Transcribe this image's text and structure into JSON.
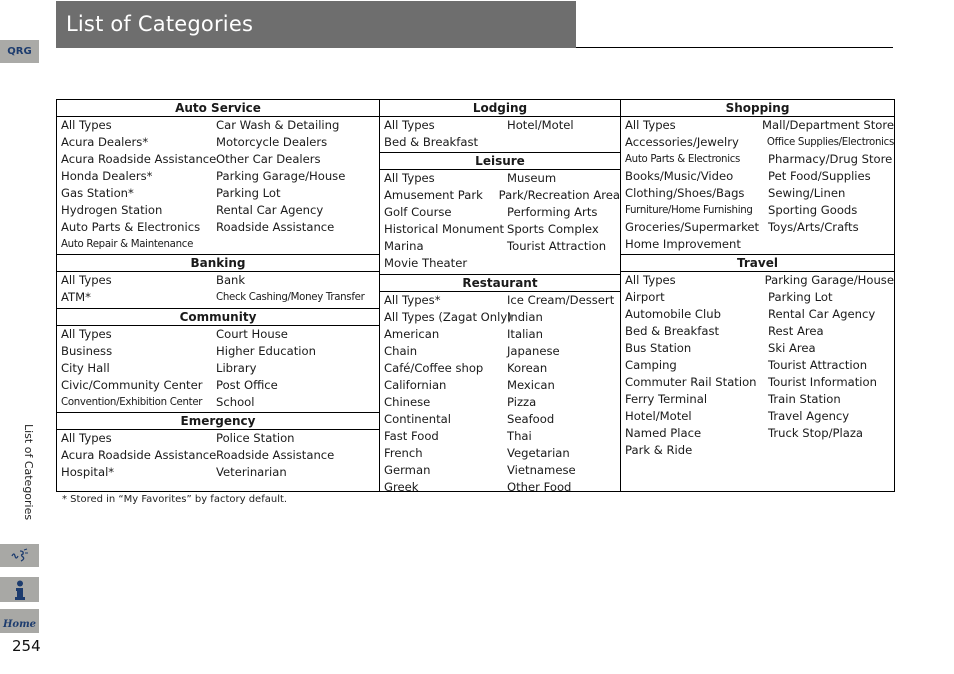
{
  "header": {
    "title": "List of Categories"
  },
  "sidebar": {
    "qrg_label": "QRG",
    "vertical_label": "List of Categories",
    "buttons": [
      {
        "name": "voice-command-icon",
        "glyph": "ɰ∉"
      },
      {
        "name": "info-icon",
        "glyph": "i"
      },
      {
        "name": "home-icon",
        "label": "Home"
      }
    ],
    "page_number": "254"
  },
  "columns": [
    {
      "sections": [
        {
          "title": "Auto Service",
          "rows": [
            [
              "All Types",
              "Car Wash & Detailing"
            ],
            [
              "Acura Dealers*",
              "Motorcycle Dealers"
            ],
            [
              "Acura Roadside Assistance",
              "Other Car Dealers"
            ],
            [
              "Honda Dealers*",
              "Parking Garage/House"
            ],
            [
              "Gas Station*",
              "Parking Lot"
            ],
            [
              "Hydrogen Station",
              "Rental Car Agency"
            ],
            [
              "Auto Parts & Electronics",
              "Roadside Assistance"
            ],
            [
              "Auto Repair & Maintenance",
              ""
            ]
          ]
        },
        {
          "title": "Banking",
          "rows": [
            [
              "All Types",
              "Bank"
            ],
            [
              "ATM*",
              "Check Cashing/Money Transfer"
            ]
          ]
        },
        {
          "title": "Community",
          "rows": [
            [
              "All Types",
              "Court House"
            ],
            [
              "Business",
              "Higher Education"
            ],
            [
              "City Hall",
              "Library"
            ],
            [
              "Civic/Community Center",
              "Post Office"
            ],
            [
              "Convention/Exhibition Center",
              "School"
            ]
          ]
        },
        {
          "title": "Emergency",
          "rows": [
            [
              "All Types",
              "Police Station"
            ],
            [
              "Acura Roadside Assistance",
              "Roadside Assistance"
            ],
            [
              "Hospital*",
              "Veterinarian"
            ]
          ]
        }
      ]
    },
    {
      "sections": [
        {
          "title": "Lodging",
          "rows": [
            [
              "All Types",
              "Hotel/Motel"
            ],
            [
              "Bed & Breakfast",
              ""
            ]
          ]
        },
        {
          "title": "Leisure",
          "rows": [
            [
              "All Types",
              "Museum"
            ],
            [
              "Amusement Park",
              "Park/Recreation Area"
            ],
            [
              "Golf Course",
              "Performing Arts"
            ],
            [
              "Historical Monument",
              "Sports Complex"
            ],
            [
              "Marina",
              "Tourist Attraction"
            ],
            [
              "Movie Theater",
              ""
            ]
          ]
        },
        {
          "title": "Restaurant",
          "rows": [
            [
              "All Types*",
              "Ice Cream/Dessert"
            ],
            [
              "All Types (Zagat Only)",
              "Indian"
            ],
            [
              "American",
              "Italian"
            ],
            [
              "Chain",
              "Japanese"
            ],
            [
              "Café/Coffee shop",
              "Korean"
            ],
            [
              "Californian",
              "Mexican"
            ],
            [
              "Chinese",
              "Pizza"
            ],
            [
              "Continental",
              "Seafood"
            ],
            [
              "Fast Food",
              "Thai"
            ],
            [
              "French",
              "Vegetarian"
            ],
            [
              "German",
              "Vietnamese"
            ],
            [
              "Greek",
              "Other Food"
            ]
          ]
        }
      ]
    },
    {
      "sections": [
        {
          "title": "Shopping",
          "rows": [
            [
              "All Types",
              "Mall/Department Store"
            ],
            [
              "Accessories/Jewelry",
              "Office Supplies/Electronics"
            ],
            [
              "Auto Parts & Electronics",
              "Pharmacy/Drug Store"
            ],
            [
              "Books/Music/Video",
              "Pet Food/Supplies"
            ],
            [
              "Clothing/Shoes/Bags",
              "Sewing/Linen"
            ],
            [
              "Furniture/Home Furnishing",
              "Sporting Goods"
            ],
            [
              "Groceries/Supermarket",
              "Toys/Arts/Crafts"
            ],
            [
              "Home Improvement",
              ""
            ]
          ]
        },
        {
          "title": "Travel",
          "rows": [
            [
              "All Types",
              "Parking Garage/House"
            ],
            [
              "Airport",
              "Parking Lot"
            ],
            [
              "Automobile Club",
              "Rental Car Agency"
            ],
            [
              "Bed & Breakfast",
              "Rest Area"
            ],
            [
              "Bus Station",
              "Ski Area"
            ],
            [
              "Camping",
              "Tourist Attraction"
            ],
            [
              "Commuter Rail Station",
              "Tourist Information"
            ],
            [
              "Ferry Terminal",
              "Train Station"
            ],
            [
              "Hotel/Motel",
              "Travel Agency"
            ],
            [
              "Named Place",
              "Truck Stop/Plaza"
            ],
            [
              "Park & Ride",
              ""
            ]
          ]
        }
      ]
    }
  ],
  "footnote": "*  Stored in “My Favorites” by factory default."
}
